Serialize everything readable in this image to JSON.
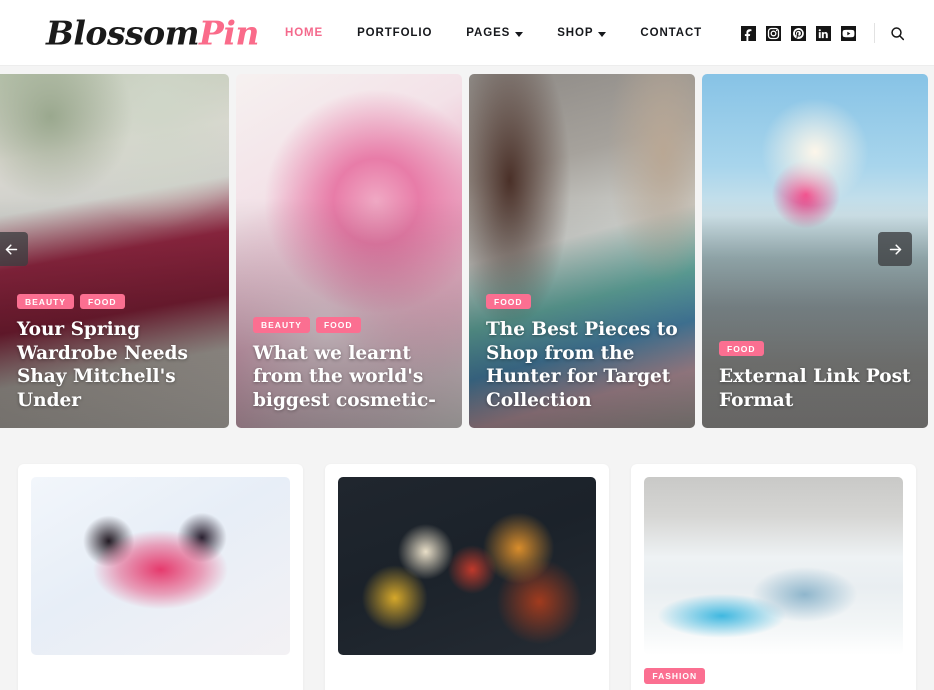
{
  "header": {
    "logo": {
      "primary": "Blossom",
      "accent": "Pin"
    },
    "nav": [
      {
        "label": "HOME",
        "active": true,
        "caret": false
      },
      {
        "label": "PORTFOLIO",
        "active": false,
        "caret": false
      },
      {
        "label": "PAGES",
        "active": false,
        "caret": true
      },
      {
        "label": "SHOP",
        "active": false,
        "caret": true
      },
      {
        "label": "CONTACT",
        "active": false,
        "caret": false
      }
    ],
    "social": [
      {
        "name": "facebook-icon"
      },
      {
        "name": "instagram-icon"
      },
      {
        "name": "pinterest-icon"
      },
      {
        "name": "linkedin-icon"
      },
      {
        "name": "youtube-icon"
      }
    ],
    "search_icon": "search-icon"
  },
  "slider": {
    "prev_label": "←",
    "next_label": "→",
    "slides": [
      {
        "tags": [
          "BEAUTY",
          "FOOD"
        ],
        "title": "Your Spring Wardrobe Needs Shay Mitchell's Under"
      },
      {
        "tags": [
          "BEAUTY",
          "FOOD"
        ],
        "title": "What we learnt from the world's biggest cosmetic-"
      },
      {
        "tags": [
          "FOOD"
        ],
        "title": "The Best Pieces to Shop from the Hunter for Target Collection"
      },
      {
        "tags": [
          "FOOD"
        ],
        "title": "External Link Post Format"
      }
    ]
  },
  "posts": [
    {
      "tag": ""
    },
    {
      "tag": ""
    },
    {
      "tag": "FASHION"
    }
  ],
  "colors": {
    "accent_pink": "#fb6f91",
    "nav_active": "#f4698c",
    "page_bg": "#f4f4f4",
    "header_bg": "#ffffff",
    "card_bg": "#ffffff"
  }
}
